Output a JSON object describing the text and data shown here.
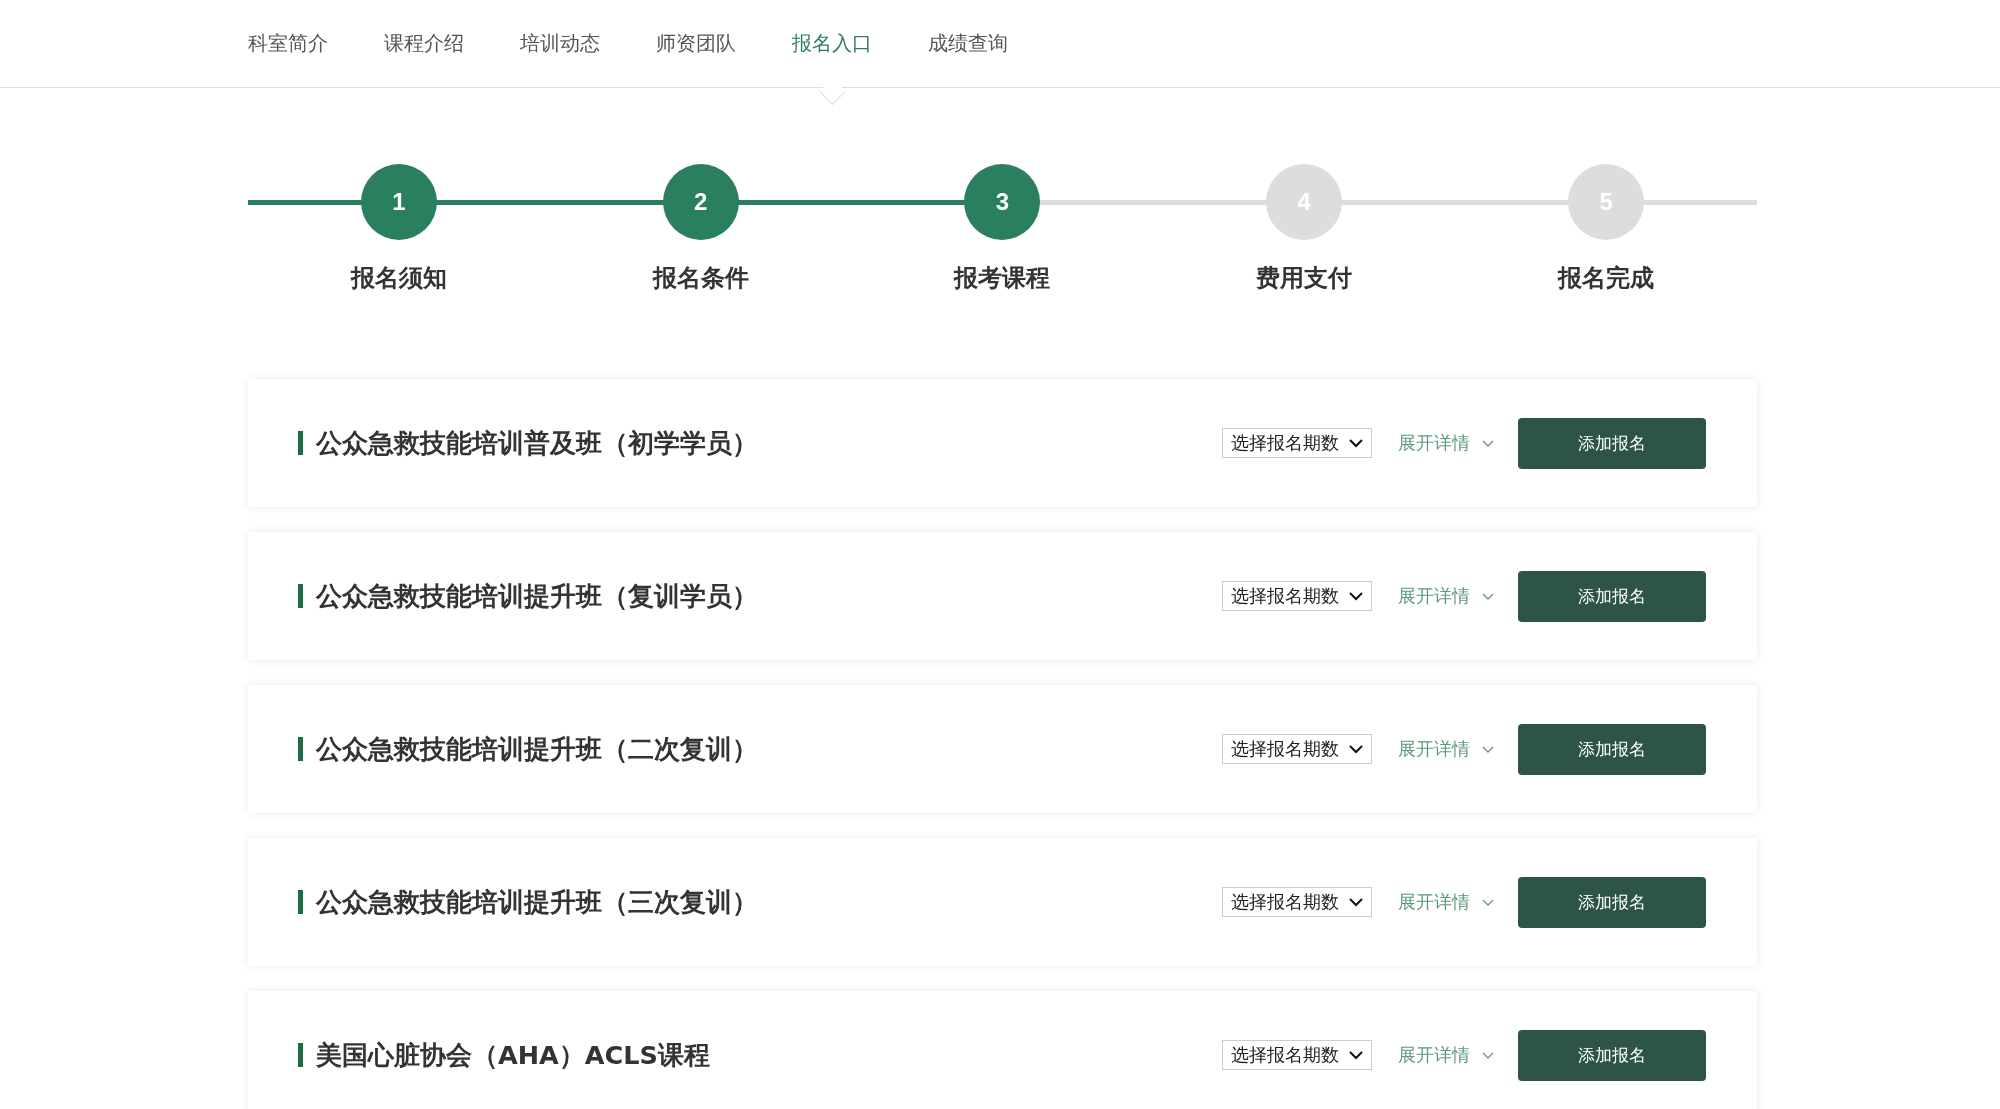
{
  "nav": [
    {
      "label": "科室简介",
      "selected": false
    },
    {
      "label": "课程介绍",
      "selected": false
    },
    {
      "label": "培训动态",
      "selected": false
    },
    {
      "label": "师资团队",
      "selected": false
    },
    {
      "label": "报名入口",
      "selected": true
    },
    {
      "label": "成绩查询",
      "selected": false
    }
  ],
  "steps": [
    {
      "number": "1",
      "label": "报名须知",
      "done": true
    },
    {
      "number": "2",
      "label": "报名条件",
      "done": true
    },
    {
      "number": "3",
      "label": "报考课程",
      "done": true
    },
    {
      "number": "4",
      "label": "费用支付",
      "done": false
    },
    {
      "number": "5",
      "label": "报名完成",
      "done": false
    }
  ],
  "courses": [
    {
      "title": "公众急救技能培训普及班（初学学员）",
      "select": "选择报名期数",
      "details": "展开详情",
      "button": "添加报名"
    },
    {
      "title": "公众急救技能培训提升班（复训学员）",
      "select": "选择报名期数",
      "details": "展开详情",
      "button": "添加报名"
    },
    {
      "title": "公众急救技能培训提升班（二次复训）",
      "select": "选择报名期数",
      "details": "展开详情",
      "button": "添加报名"
    },
    {
      "title": "公众急救技能培训提升班（三次复训）",
      "select": "选择报名期数",
      "details": "展开详情",
      "button": "添加报名"
    },
    {
      "title": "美国心脏协会（AHA）ACLS课程",
      "select": "选择报名期数",
      "details": "展开详情",
      "button": "添加报名"
    }
  ]
}
